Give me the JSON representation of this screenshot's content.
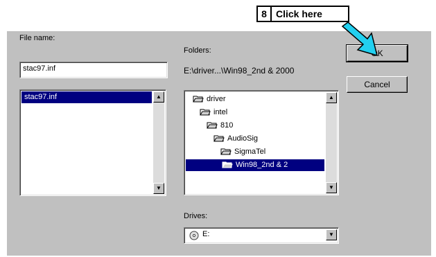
{
  "callout": {
    "step": "8",
    "text": "Click here"
  },
  "file_name": {
    "label": "File name:",
    "value": "stac97.inf",
    "files": [
      "stac97.inf"
    ]
  },
  "folders": {
    "label": "Folders:",
    "path": "E:\\driver...\\Win98_2nd & 2000",
    "tree": [
      "driver",
      "intel",
      "810",
      "AudioSig",
      "SigmaTel",
      "Win98_2nd & 2"
    ]
  },
  "buttons": {
    "ok": "OK",
    "cancel": "Cancel"
  },
  "drives": {
    "label": "Drives:",
    "value": "E:"
  },
  "colors": {
    "dialog_bg": "#c0c0c0",
    "selection": "#000080",
    "arrow": "#22d0f0"
  }
}
